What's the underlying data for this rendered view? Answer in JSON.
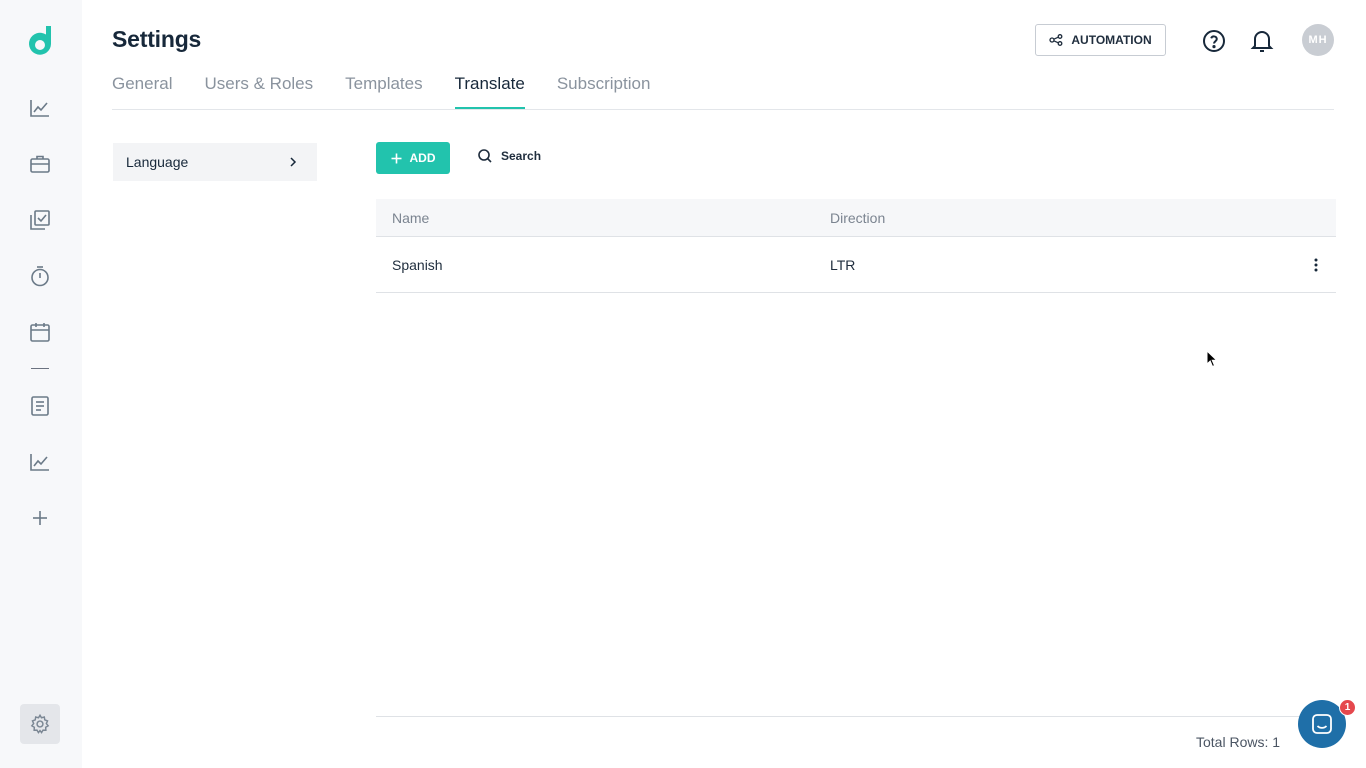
{
  "app": {
    "accent": "#22c3ad",
    "title": "Settings"
  },
  "header": {
    "automation_label": "AUTOMATION",
    "avatar_initials": "MH"
  },
  "tabs": [
    {
      "label": "General",
      "active": false
    },
    {
      "label": "Users & Roles",
      "active": false
    },
    {
      "label": "Templates",
      "active": false
    },
    {
      "label": "Translate",
      "active": true
    },
    {
      "label": "Subscription",
      "active": false
    }
  ],
  "sidebar": {
    "icons": [
      "dashboard-chart-icon",
      "briefcase-icon",
      "tasks-icon",
      "timer-icon",
      "calendar-icon",
      "document-icon",
      "reports-chart-icon",
      "add-icon",
      "settings-gear-icon"
    ]
  },
  "subnav": {
    "item_label": "Language"
  },
  "toolbar": {
    "add_label": "ADD",
    "search_label": "Search"
  },
  "table": {
    "columns": [
      "Name",
      "Direction"
    ],
    "rows": [
      {
        "name": "Spanish",
        "direction": "LTR"
      }
    ],
    "total_rows_label": "Total Rows: 1"
  },
  "chat": {
    "badge_count": "1"
  }
}
